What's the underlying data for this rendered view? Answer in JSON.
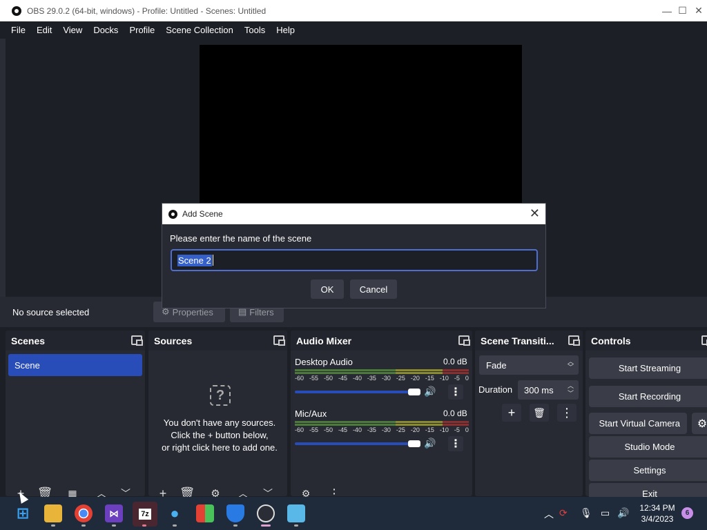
{
  "window": {
    "title": "OBS 29.0.2 (64-bit, windows) - Profile: Untitled - Scenes: Untitled",
    "minimize": "—",
    "maximize": "☐",
    "close": "✕"
  },
  "menu": [
    "File",
    "Edit",
    "View",
    "Docks",
    "Profile",
    "Scene Collection",
    "Tools",
    "Help"
  ],
  "context": {
    "no_source": "No source selected",
    "properties": "Properties",
    "filters": "Filters"
  },
  "dialog": {
    "title": "Add Scene",
    "prompt": "Please enter the name of the scene",
    "value": "Scene 2",
    "ok": "OK",
    "cancel": "Cancel",
    "close": "✕"
  },
  "scenes": {
    "header": "Scenes",
    "items": [
      "Scene"
    ]
  },
  "sources": {
    "header": "Sources",
    "empty_icon": "?",
    "empty_line1": "You don't have any sources.",
    "empty_line2": "Click the + button below,",
    "empty_line3": "or right click here to add one."
  },
  "audio_mixer": {
    "header": "Audio Mixer",
    "channels": [
      {
        "name": "Desktop Audio",
        "db": "0.0 dB",
        "volume": 0.95
      },
      {
        "name": "Mic/Aux",
        "db": "0.0 dB",
        "volume": 0.95
      }
    ],
    "scale": [
      "-60",
      "-55",
      "-50",
      "-45",
      "-40",
      "-35",
      "-30",
      "-25",
      "-20",
      "-15",
      "-10",
      "-5",
      "0"
    ]
  },
  "transitions": {
    "header": "Scene Transiti...",
    "selected": "Fade",
    "duration_label": "Duration",
    "duration_value": "300 ms"
  },
  "controls": {
    "header": "Controls",
    "start_streaming": "Start Streaming",
    "start_recording": "Start Recording",
    "start_virtual_camera": "Start Virtual Camera",
    "studio_mode": "Studio Mode",
    "settings": "Settings",
    "exit": "Exit"
  },
  "taskbar": {
    "time": "12:34 PM",
    "date": "3/4/2023",
    "notifications": "6",
    "apps": [
      "start-icon",
      "file-explorer-icon",
      "chrome-icon",
      "visual-studio-icon",
      "7zip-icon",
      "tips-icon",
      "store-icon",
      "defender-icon",
      "obs-icon",
      "app-icon"
    ]
  },
  "colors": {
    "accent": "#284cb8",
    "background": "#1d1f26",
    "dock": "#272a33",
    "taskbar": "#1f2a3a"
  }
}
